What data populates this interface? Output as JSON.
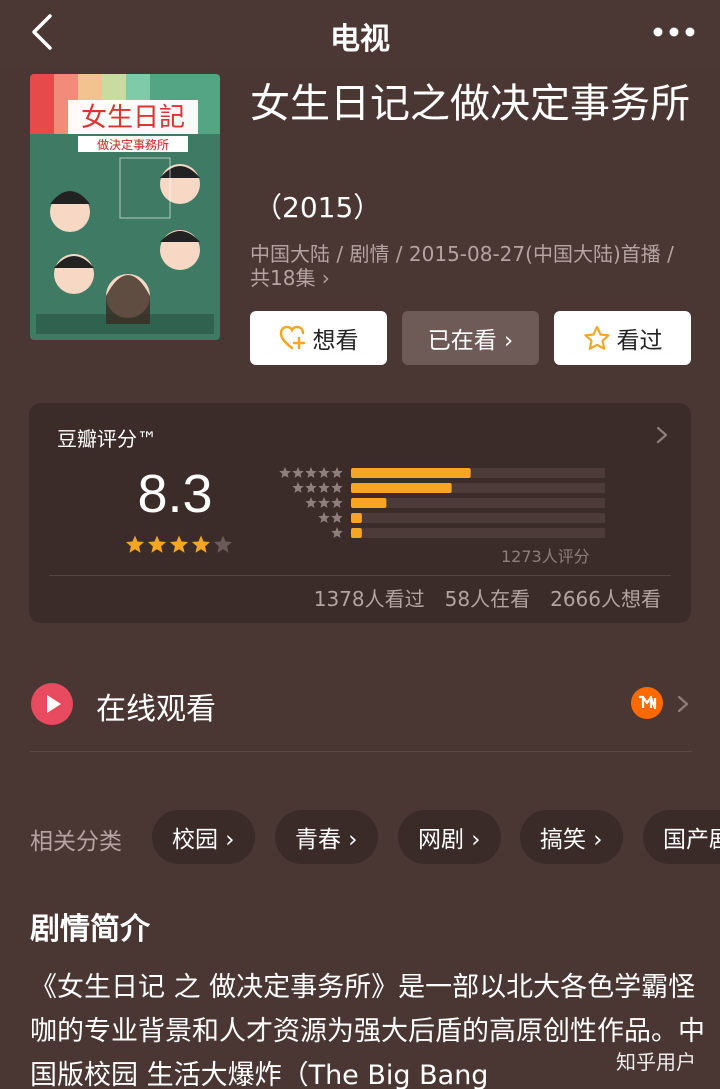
{
  "header": {
    "title": "电视"
  },
  "movie": {
    "title": "女生日记之做决定事务所",
    "year": "（2015）",
    "meta": "中国大陆 / 剧情 / 2015-08-27(中国大陆)首播 / 共18集 ›",
    "poster": {
      "title": "女生日記",
      "subtitle": "做決定事務所"
    }
  },
  "actions": {
    "want": "想看",
    "watching": "已在看 ›",
    "watched": "看过"
  },
  "rating": {
    "label": "豆瓣评分™",
    "score": "8.3",
    "stars": 4,
    "distribution": [
      0.44,
      0.37,
      0.13,
      0.04,
      0.04
    ],
    "count": "1273人评分",
    "stats": [
      "1378人看过",
      "58人在看",
      "2666人想看"
    ]
  },
  "online": {
    "label": "在线观看"
  },
  "categories": {
    "label": "相关分类",
    "items": [
      "校园 ›",
      "青春 ›",
      "网剧 ›",
      "搞笑 ›",
      "国产剧"
    ]
  },
  "synopsis": {
    "title": "剧情简介",
    "text": "《女生日记 之 做决定事务所》是一部以北大各色学霸怪咖的专业背景和人才资源为强大后盾的高原创性作品。中国版校园 生活大爆炸（The Big Bang"
  },
  "watermark": "知乎用户",
  "colors": {
    "background": "#4a3733",
    "card": "#3c2c29",
    "star": "#f5a623",
    "play": "#e84a5f"
  }
}
